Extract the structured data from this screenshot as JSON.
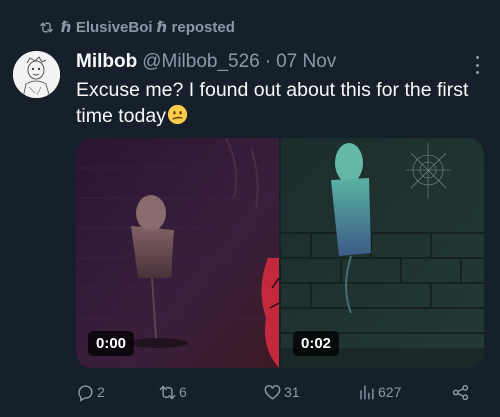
{
  "repost": {
    "text": "ℏ ElusiveBoi ℏ reposted"
  },
  "tweet": {
    "display_name": "Milbob",
    "handle": "@Milbob_526",
    "separator": "·",
    "date": "07 Nov",
    "text": "Excuse me? I found out about this for the first time today",
    "emoji": "confused-face-emoji"
  },
  "media": [
    {
      "duration": "0:00"
    },
    {
      "duration": "0:02"
    }
  ],
  "actions": {
    "replies": "2",
    "reposts": "6",
    "likes": "31",
    "views": "627"
  },
  "colors": {
    "background": "#15202b",
    "text": "#f7f9f9",
    "muted": "#8b98a5"
  }
}
